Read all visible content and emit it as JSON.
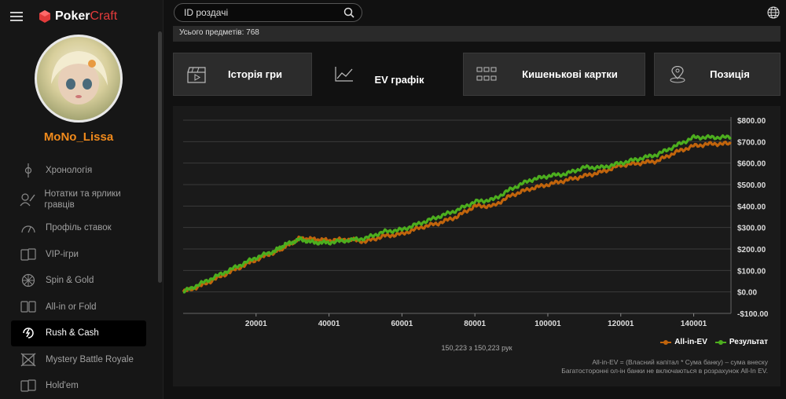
{
  "app": {
    "logo_main": "Poker",
    "logo_accent": "Craft",
    "username": "MoNo_Lissa"
  },
  "search": {
    "placeholder": "ID роздачі"
  },
  "count_bar": {
    "text": "Усього предметів: 768"
  },
  "nav": {
    "items": [
      {
        "label": "Хронологія",
        "icon": "timeline-icon",
        "active": false
      },
      {
        "label": "Нотатки та ярлики гравців",
        "icon": "player-notes-icon",
        "active": false
      },
      {
        "label": "Профіль ставок",
        "icon": "gauge-icon",
        "active": false
      },
      {
        "label": "VIP-ігри",
        "icon": "vip-cards-icon",
        "active": false
      },
      {
        "label": "Spin & Gold",
        "icon": "spin-wheel-icon",
        "active": false
      },
      {
        "label": "All-in or Fold",
        "icon": "all-in-icon",
        "active": false
      },
      {
        "label": "Rush & Cash",
        "icon": "rush-cash-icon",
        "active": true
      },
      {
        "label": "Mystery Battle Royale",
        "icon": "battle-royale-icon",
        "active": false
      },
      {
        "label": "Hold'em",
        "icon": "holdem-cards-icon",
        "active": false
      }
    ]
  },
  "tabs": [
    {
      "label": "Історія гри",
      "icon": "clapper-icon",
      "active": false
    },
    {
      "label": "EV графік",
      "icon": "line-chart-icon",
      "active": true
    },
    {
      "label": "Кишенькові картки",
      "icon": "grid-icon",
      "active": false
    },
    {
      "label": "Позиція",
      "icon": "location-pin-icon",
      "active": false
    }
  ],
  "chart_footer": {
    "summary": "150,223 з 150,223 рук",
    "note1": "All-in-EV = (Власний капітал * Сума банку) – сума внеску",
    "note2": "Багатосторонні ол-ін банки не включаються в розрахунок All-In EV."
  },
  "colors": {
    "allin_ev": "#c0640c",
    "result": "#4cae1e",
    "accent": "#f08a1c"
  },
  "chart_data": {
    "type": "line",
    "title": "",
    "xlabel": "",
    "ylabel": "",
    "xlim": [
      0,
      150223
    ],
    "ylim": [
      -100,
      800
    ],
    "x_ticks": [
      20001,
      40001,
      60001,
      80001,
      100001,
      120001,
      140001
    ],
    "y_ticks": [
      "$800.00",
      "$700.00",
      "$600.00",
      "$500.00",
      "$400.00",
      "$300.00",
      "$200.00",
      "$100.00",
      "$0.00",
      "-$100.00"
    ],
    "y_tick_values": [
      800,
      700,
      600,
      500,
      400,
      300,
      200,
      100,
      0,
      -100
    ],
    "grid": true,
    "legend_position": "bottom-right",
    "x": [
      0,
      5000,
      10000,
      15000,
      20000,
      25000,
      28000,
      32000,
      36000,
      40000,
      45000,
      50000,
      55000,
      60000,
      65000,
      70000,
      75000,
      80000,
      85000,
      90000,
      95000,
      100000,
      105000,
      110000,
      115000,
      120000,
      125000,
      130000,
      135000,
      140000,
      145000,
      150223
    ],
    "series": [
      {
        "name": "All-in-EV",
        "values": [
          0,
          30,
          70,
          110,
          150,
          185,
          210,
          250,
          245,
          240,
          245,
          235,
          260,
          270,
          300,
          320,
          350,
          400,
          400,
          450,
          480,
          500,
          520,
          540,
          560,
          590,
          600,
          610,
          650,
          680,
          690,
          690
        ]
      },
      {
        "name": "Результат",
        "values": [
          0,
          40,
          80,
          120,
          160,
          190,
          220,
          245,
          230,
          230,
          240,
          250,
          280,
          290,
          320,
          350,
          380,
          420,
          430,
          480,
          520,
          540,
          550,
          580,
          580,
          600,
          620,
          640,
          680,
          720,
          720,
          720
        ]
      }
    ]
  }
}
